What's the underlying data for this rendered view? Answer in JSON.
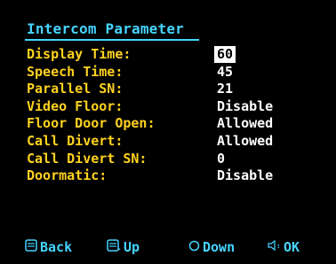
{
  "screen": {
    "title": "Intercom Parameter",
    "params": [
      {
        "label": "Display Time:",
        "value": "60",
        "selected": true
      },
      {
        "label": "Speech Time:",
        "value": "45",
        "selected": false
      },
      {
        "label": "Parallel SN:",
        "value": "21",
        "selected": false
      },
      {
        "label": "Video Floor:",
        "value": "Disable",
        "selected": false
      },
      {
        "label": "Floor Door Open:",
        "value": "Allowed",
        "selected": false
      },
      {
        "label": "Call Divert:",
        "value": "Allowed",
        "selected": false
      },
      {
        "label": "Call Divert SN:",
        "value": "0",
        "selected": false
      },
      {
        "label": "Doormatic:",
        "value": "Disable",
        "selected": false
      }
    ]
  },
  "footer": {
    "back": {
      "label": "Back",
      "icon": "back-key-icon"
    },
    "up": {
      "label": "Up",
      "icon": "up-key-icon"
    },
    "down": {
      "label": "Down",
      "icon": "down-key-icon"
    },
    "ok": {
      "label": "OK",
      "icon": "ok-key-icon"
    }
  },
  "colors": {
    "background": "#000000",
    "title": "#46d4ff",
    "label": "#ffd21f",
    "value": "#ffffff",
    "footer": "#46d4ff"
  }
}
